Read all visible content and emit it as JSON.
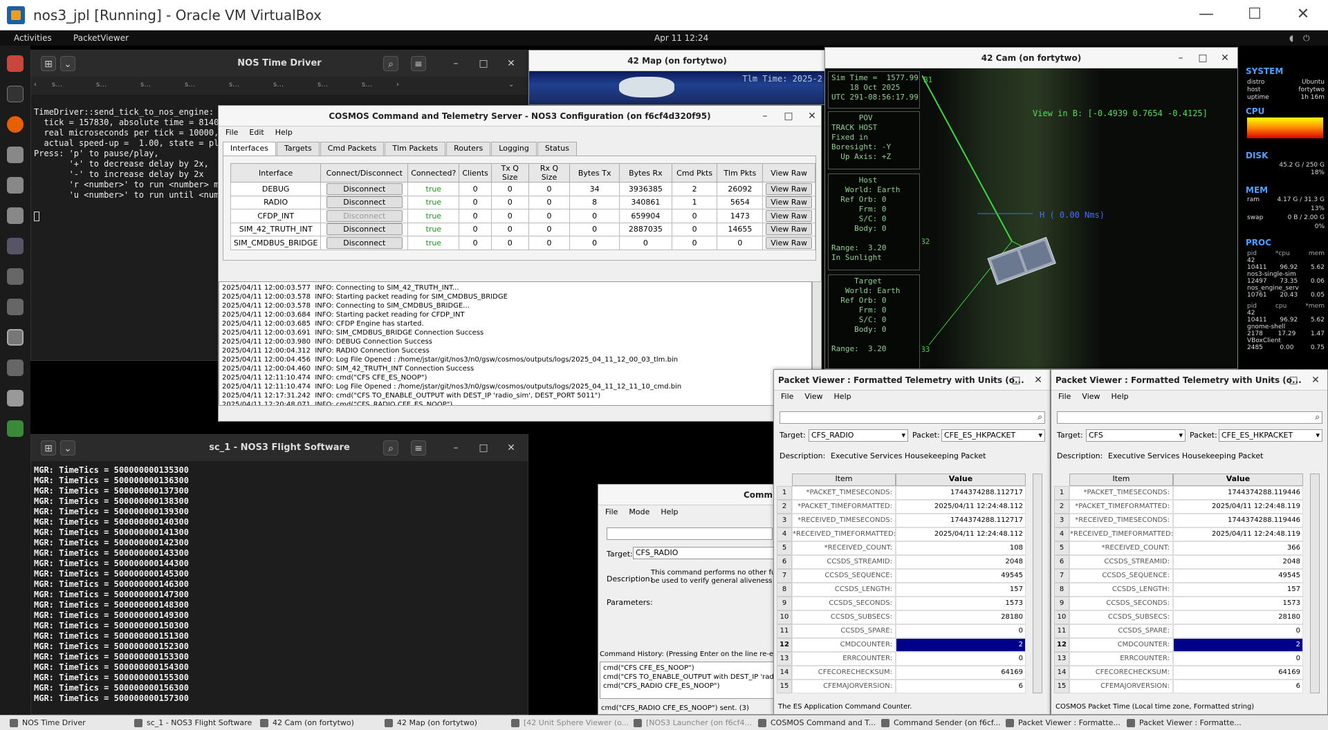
{
  "vbox": {
    "title": "nos3_jpl [Running] - Oracle VM VirtualBox",
    "minimize": "—",
    "maximize": "☐",
    "close": "✕"
  },
  "topbar": {
    "activities": "Activities",
    "app": "PacketViewer",
    "clock": "Apr 11  12:24"
  },
  "time_driver": {
    "title": "NOS Time Driver",
    "tabs": [
      "s…",
      "s…",
      "s…",
      "s…",
      "s…",
      "s…",
      "s…",
      "s…"
    ],
    "lines": [
      "TimeDriver::send_tick_to_nos_engine:",
      "  tick = 157830, absolute time = 81404",
      "  real microseconds per tick = 10000,",
      "  actual speed-up =  1.00, state = pla",
      "",
      "Press: 'p' to pause/play,",
      "       '+' to decrease delay by 2x,",
      "       '-' to increase delay by 2x",
      "       'r <number>' to run <number> mo",
      "       'u <number>' to run until <numb"
    ]
  },
  "flight_sw": {
    "title": "sc_1 - NOS3 Flight Software",
    "lines": [
      "MGR: TimeTics = 500000000135300",
      "MGR: TimeTics = 500000000136300",
      "MGR: TimeTics = 500000000137300",
      "MGR: TimeTics = 500000000138300",
      "MGR: TimeTics = 500000000139300",
      "MGR: TimeTics = 500000000140300",
      "MGR: TimeTics = 500000000141300",
      "MGR: TimeTics = 500000000142300",
      "MGR: TimeTics = 500000000143300",
      "MGR: TimeTics = 500000000144300",
      "MGR: TimeTics = 500000000145300",
      "MGR: TimeTics = 500000000146300",
      "MGR: TimeTics = 500000000147300",
      "MGR: TimeTics = 500000000148300",
      "MGR: TimeTics = 500000000149300",
      "MGR: TimeTics = 500000000150300",
      "MGR: TimeTics = 500000000151300",
      "MGR: TimeTics = 500000000152300",
      "MGR: TimeTics = 500000000153300",
      "MGR: TimeTics = 500000000154300",
      "MGR: TimeTics = 500000000155300",
      "MGR: TimeTics = 500000000156300",
      "MGR: TimeTics = 500000000157300"
    ]
  },
  "map42": {
    "title": "42 Map (on fortytwo)",
    "tlm": "Tlm Time:  2025-2"
  },
  "cam42": {
    "title": "42 Cam (on fortytwo)",
    "sim": [
      "Sim Time =  1577.99",
      "    18 Oct 2025",
      "UTC 291-08:56:17.99"
    ],
    "pov": [
      "      POV",
      "TRACK HOST",
      "Fixed in",
      "Boresight: -Y",
      "  Up Axis: +Z"
    ],
    "host": [
      "      Host",
      "   World: Earth",
      "  Ref Orb: 0",
      "      Frm: 0",
      "      S/C: 0",
      "     Body: 0",
      "",
      "Range:  3.20",
      "In Sunlight"
    ],
    "target": [
      "     Target",
      "   World: Earth",
      "  Ref Orb: 0",
      "      Frm: 0",
      "      S/C: 0",
      "     Body: 0",
      "",
      "Range:  3.20"
    ],
    "view": "View in B: [-0.4939  0.7654 -0.4125]",
    "h_label": "H  ( 0.00 Nms)",
    "axes": [
      "B1",
      "B2",
      "B3"
    ]
  },
  "sysmon": {
    "system": "SYSTEM",
    "sys_rows": [
      [
        "distro",
        "Ubuntu"
      ],
      [
        "host",
        "fortytwo"
      ],
      [
        "uptime",
        "1h 16m"
      ]
    ],
    "cpu": "CPU",
    "disk": "DISK",
    "disk_rows": [
      [
        "",
        "45.2 G / 250 G"
      ],
      [
        "",
        "18%"
      ]
    ],
    "mem": "MEM",
    "mem_rows": [
      [
        "ram",
        "4.17 G / 31.3 G"
      ],
      [
        "",
        "13%"
      ],
      [
        "swap",
        "0 B / 2.00 G"
      ],
      [
        "",
        "0%"
      ]
    ],
    "proc": "PROC",
    "proc_head": [
      "pid",
      "*cpu",
      "mem"
    ],
    "proc_rows": [
      [
        "42",
        "",
        " "
      ],
      [
        "10411",
        "96.92",
        "5.62"
      ],
      [
        "nos3-single-sim",
        "",
        ""
      ],
      [
        "12497",
        "73.35",
        "0.06"
      ],
      [
        "nos_engine_serv",
        "",
        ""
      ],
      [
        "10761",
        "20.43",
        "0.05"
      ]
    ],
    "proc_head2": [
      "pid",
      "cpu",
      "*mem"
    ],
    "proc_rows2": [
      [
        "42",
        "",
        ""
      ],
      [
        "10411",
        "96.92",
        "5.62"
      ],
      [
        "gnome-shell",
        "",
        ""
      ],
      [
        "2178",
        "17.29",
        "1.47"
      ],
      [
        "VBoxClient",
        "",
        ""
      ],
      [
        "2485",
        "0.00",
        "0.75"
      ]
    ]
  },
  "cosmos": {
    "title": "COSMOS Command and Telemetry Server - NOS3 Configuration (on f6cf4d320f95)",
    "menu": [
      "File",
      "Edit",
      "Help"
    ],
    "tabs": [
      "Interfaces",
      "Targets",
      "Cmd Packets",
      "Tlm Packets",
      "Routers",
      "Logging",
      "Status"
    ],
    "headers": [
      "Interface",
      "Connect/Disconnect",
      "Connected?",
      "Clients",
      "Tx Q Size",
      "Rx Q Size",
      "Bytes Tx",
      "Bytes Rx",
      "Cmd Pkts",
      "Tlm Pkts",
      "View Raw"
    ],
    "rows": [
      {
        "name": "DEBUG",
        "btn": "Disconnect",
        "conn": "true",
        "clients": "0",
        "txq": "0",
        "rxq": "0",
        "btx": "34",
        "brx": "3936385",
        "cmd": "2",
        "tlm": "26092",
        "raw": "View Raw"
      },
      {
        "name": "RADIO",
        "btn": "Disconnect",
        "conn": "true",
        "clients": "0",
        "txq": "0",
        "rxq": "0",
        "btx": "8",
        "brx": "340861",
        "cmd": "1",
        "tlm": "5654",
        "raw": "View Raw"
      },
      {
        "name": "CFDP_INT",
        "btn": "Disconnect",
        "conn": "true",
        "clients": "0",
        "txq": "0",
        "rxq": "0",
        "btx": "0",
        "brx": "659904",
        "cmd": "0",
        "tlm": "1473",
        "raw": "View Raw"
      },
      {
        "name": "SIM_42_TRUTH_INT",
        "btn": "Disconnect",
        "conn": "true",
        "clients": "0",
        "txq": "0",
        "rxq": "0",
        "btx": "0",
        "brx": "2887035",
        "cmd": "0",
        "tlm": "14655",
        "raw": "View Raw"
      },
      {
        "name": "SIM_CMDBUS_BRIDGE",
        "btn": "Disconnect",
        "conn": "true",
        "clients": "0",
        "txq": "0",
        "rxq": "0",
        "btx": "0",
        "brx": "0",
        "cmd": "0",
        "tlm": "0",
        "raw": "View Raw"
      }
    ],
    "log": [
      "2025/04/11 12:00:03.577  INFO: Connecting to SIM_42_TRUTH_INT...",
      "2025/04/11 12:00:03.578  INFO: Starting packet reading for SIM_CMDBUS_BRIDGE",
      "2025/04/11 12:00:03.578  INFO: Connecting to SIM_CMDBUS_BRIDGE...",
      "2025/04/11 12:00:03.684  INFO: Starting packet reading for CFDP_INT",
      "2025/04/11 12:00:03.685  INFO: CFDP Engine has started.",
      "2025/04/11 12:00:03.691  INFO: SIM_CMDBUS_BRIDGE Connection Success",
      "2025/04/11 12:00:03.980  INFO: DEBUG Connection Success",
      "2025/04/11 12:00:04.312  INFO: RADIO Connection Success",
      "2025/04/11 12:00:04.456  INFO: Log File Opened : /home/jstar/git/nos3/n0/gsw/cosmos/outputs/logs/2025_04_11_12_00_03_tlm.bin",
      "2025/04/11 12:00:04.460  INFO: SIM_42_TRUTH_INT Connection Success",
      "2025/04/11 12:11:10.474  INFO: cmd(\"CFS CFE_ES_NOOP\")",
      "2025/04/11 12:11:10.474  INFO: Log File Opened : /home/jstar/git/nos3/n0/gsw/cosmos/outputs/logs/2025_04_11_12_11_10_cmd.bin",
      "2025/04/11 12:17:31.242  INFO: cmd(\"CFS TO_ENABLE_OUTPUT with DEST_IP 'radio_sim', DEST_PORT 5011\")",
      "2025/04/11 12:20:48.071  INFO: cmd(\"CFS_RADIO CFE_ES_NOOP\")"
    ]
  },
  "cmdsender": {
    "title": "Comm",
    "menu": [
      "File",
      "Mode",
      "Help"
    ],
    "target_label": "Target:",
    "target": "CFS_RADIO",
    "desc_label": "Description:",
    "desc": "This command performs no other fun\nbe used to verify general aliveness o",
    "params": "Parameters:",
    "history_label": "Command History: (Pressing Enter on the line re-exe",
    "history": [
      "cmd(\"CFS CFE_ES_NOOP\")",
      "cmd(\"CFS TO_ENABLE_OUTPUT with DEST_IP 'radio",
      "cmd(\"CFS_RADIO CFE_ES_NOOP\")"
    ],
    "status": "cmd(\"CFS_RADIO CFE_ES_NOOP\") sent. (3)"
  },
  "pv1": {
    "title": "Packet Viewer : Formatted Telemetry with Units (o...",
    "menu": [
      "File",
      "View",
      "Help"
    ],
    "target_label": "Target:",
    "target": "CFS_RADIO",
    "packet_label": "Packet:",
    "packet": "CFE_ES_HKPACKET",
    "desc_label": "Description:",
    "desc": "Executive Services Housekeeping Packet",
    "col_item": "Item",
    "col_value": "Value",
    "rows": [
      [
        "1",
        "*PACKET_TIMESECONDS:",
        "1744374288.112717"
      ],
      [
        "2",
        "*PACKET_TIMEFORMATTED:",
        "2025/04/11 12:24:48.112"
      ],
      [
        "3",
        "*RECEIVED_TIMESECONDS:",
        "1744374288.112717"
      ],
      [
        "4",
        "*RECEIVED_TIMEFORMATTED:",
        "2025/04/11 12:24:48.112"
      ],
      [
        "5",
        "*RECEIVED_COUNT:",
        "108"
      ],
      [
        "6",
        "CCSDS_STREAMID:",
        "2048"
      ],
      [
        "7",
        "CCSDS_SEQUENCE:",
        "49545"
      ],
      [
        "8",
        "CCSDS_LENGTH:",
        "157"
      ],
      [
        "9",
        "CCSDS_SECONDS:",
        "1573"
      ],
      [
        "10",
        "CCSDS_SUBSECS:",
        "28180"
      ],
      [
        "11",
        "CCSDS_SPARE:",
        "0"
      ],
      [
        "12",
        "CMDCOUNTER:",
        "2"
      ],
      [
        "13",
        "ERRCOUNTER:",
        "0"
      ],
      [
        "14",
        "CFECORECHECKSUM:",
        "64169"
      ],
      [
        "15",
        "CFEMAJORVERSION:",
        "6"
      ]
    ],
    "status": "The ES Application Command Counter."
  },
  "pv2": {
    "title": "Packet Viewer : Formatted Telemetry with Units (o...",
    "menu": [
      "File",
      "View",
      "Help"
    ],
    "target_label": "Target:",
    "target": "CFS",
    "packet_label": "Packet:",
    "packet": "CFE_ES_HKPACKET",
    "desc_label": "Description:",
    "desc": "Executive Services Housekeeping Packet",
    "col_item": "Item",
    "col_value": "Value",
    "rows": [
      [
        "1",
        "*PACKET_TIMESECONDS:",
        "1744374288.119446"
      ],
      [
        "2",
        "*PACKET_TIMEFORMATTED:",
        "2025/04/11 12:24:48.119"
      ],
      [
        "3",
        "*RECEIVED_TIMESECONDS:",
        "1744374288.119446"
      ],
      [
        "4",
        "*RECEIVED_TIMEFORMATTED:",
        "2025/04/11 12:24:48.119"
      ],
      [
        "5",
        "*RECEIVED_COUNT:",
        "366"
      ],
      [
        "6",
        "CCSDS_STREAMID:",
        "2048"
      ],
      [
        "7",
        "CCSDS_SEQUENCE:",
        "49545"
      ],
      [
        "8",
        "CCSDS_LENGTH:",
        "157"
      ],
      [
        "9",
        "CCSDS_SECONDS:",
        "1573"
      ],
      [
        "10",
        "CCSDS_SUBSECS:",
        "28180"
      ],
      [
        "11",
        "CCSDS_SPARE:",
        "0"
      ],
      [
        "12",
        "CMDCOUNTER:",
        "2"
      ],
      [
        "13",
        "ERRCOUNTER:",
        "0"
      ],
      [
        "14",
        "CFECORECHECKSUM:",
        "64169"
      ],
      [
        "15",
        "CFEMAJORVERSION:",
        "6"
      ]
    ],
    "status": "COSMOS Packet Time (Local time zone, Formatted string)"
  },
  "taskbar": [
    "NOS Time Driver",
    "sc_1 - NOS3 Flight Software",
    "42 Cam (on fortytwo)",
    "42 Map (on fortytwo)",
    "[42 Unit Sphere Viewer (o...",
    "[NOS3 Launcher (on f6cf4...",
    "COSMOS Command and T...",
    "Command Sender (on f6cf...",
    "Packet Viewer : Formatte...",
    "Packet Viewer : Formatte..."
  ],
  "colors": {
    "selected": "#00008b",
    "true": "#1a9a1a",
    "cam_green": "#8fd08f"
  }
}
